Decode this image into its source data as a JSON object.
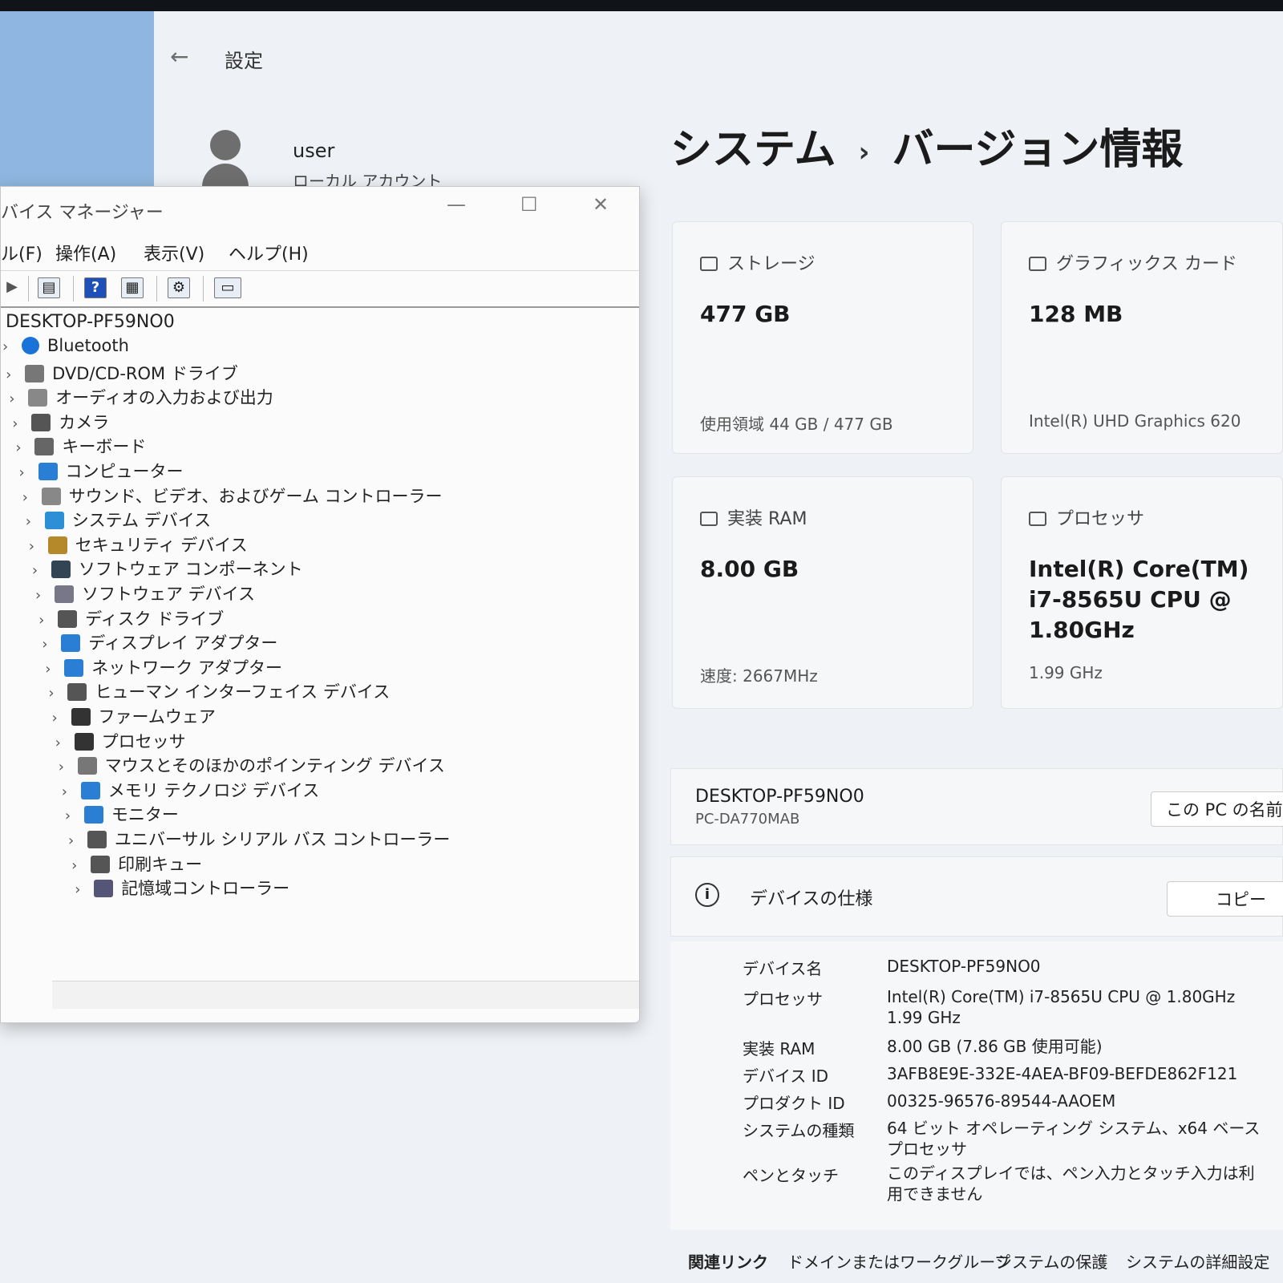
{
  "settings": {
    "app_title": "設定",
    "user": {
      "name": "user",
      "account_type": "ローカル アカウント"
    },
    "breadcrumb": {
      "parent": "システム",
      "current": "バージョン情報"
    },
    "cards": {
      "storage": {
        "label": "ストレージ",
        "value": "477 GB",
        "sub": "使用領域 44 GB / 477 GB"
      },
      "graphics": {
        "label": "グラフィックス カード",
        "value": "128 MB",
        "sub": "Intel(R) UHD Graphics 620"
      },
      "ram": {
        "label": "実装 RAM",
        "value": "8.00 GB",
        "sub": "速度: 2667MHz"
      },
      "processor": {
        "label": "プロセッサ",
        "value": "Intel(R) Core(TM) i7-8565U CPU @ 1.80GHz",
        "sub": "1.99 GHz"
      }
    },
    "pc": {
      "name": "DESKTOP-PF59NO0",
      "model": "PC-DA770MAB",
      "rename_label": "この PC の名前を"
    },
    "spec": {
      "title": "デバイスの仕様",
      "copy_label": "コピー",
      "rows": [
        {
          "key": "デバイス名",
          "value": "DESKTOP-PF59NO0"
        },
        {
          "key": "プロセッサ",
          "value": "Intel(R) Core(TM) i7-8565U CPU @ 1.80GHz 1.99 GHz"
        },
        {
          "key": "実装 RAM",
          "value": "8.00 GB (7.86 GB 使用可能)"
        },
        {
          "key": "デバイス ID",
          "value": "3AFB8E9E-332E-4AEA-BF09-BEFDE862F121"
        },
        {
          "key": "プロダクト ID",
          "value": "00325-96576-89544-AAOEM"
        },
        {
          "key": "システムの種類",
          "value": "64 ビット オペレーティング システム、x64 ベース プロセッサ"
        },
        {
          "key": "ペンとタッチ",
          "value": "このディスプレイでは、ペン入力とタッチ入力は利用できません"
        }
      ]
    },
    "related": {
      "label": "関連リンク",
      "links": [
        "ドメインまたはワークグループ",
        "システムの保護",
        "システムの詳細設定"
      ]
    }
  },
  "device_manager": {
    "title": "バイス マネージャー",
    "menu": [
      "ル(F)",
      "操作(A)",
      "表示(V)",
      "ヘルプ(H)"
    ],
    "root": "DESKTOP-PF59NO0",
    "items": [
      "Bluetooth",
      "DVD/CD-ROM ドライブ",
      "オーディオの入力および出力",
      "カメラ",
      "キーボード",
      "コンピューター",
      "サウンド、ビデオ、およびゲーム コントローラー",
      "システム デバイス",
      "セキュリティ デバイス",
      "ソフトウェア コンポーネント",
      "ソフトウェア デバイス",
      "ディスク ドライブ",
      "ディスプレイ アダプター",
      "ネットワーク アダプター",
      "ヒューマン インターフェイス デバイス",
      "ファームウェア",
      "プロセッサ",
      "マウスとそのほかのポインティング デバイス",
      "メモリ テクノロジ デバイス",
      "モニター",
      "ユニバーサル シリアル バス コントローラー",
      "印刷キュー",
      "記憶域コントローラー"
    ]
  },
  "colors": {
    "accent": "#1e64c8",
    "bluetooth": "#1a73d9",
    "window_bg": "#fbfbfb"
  }
}
